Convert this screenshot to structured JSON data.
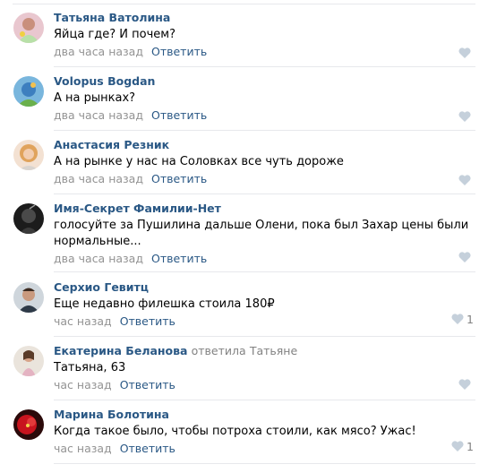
{
  "comments": [
    {
      "author": "Татьяна Ватолина",
      "text": "Яйца где? И почем?",
      "date": "два часа назад",
      "reply_label": "Ответить",
      "likes": ""
    },
    {
      "author": "Volopus Bogdan",
      "text": "А на рынках?",
      "date": "два часа назад",
      "reply_label": "Ответить",
      "likes": ""
    },
    {
      "author": "Анастасия Резник",
      "text": "А на рынке у нас на Соловках все чуть дороже",
      "date": "два часа назад",
      "reply_label": "Ответить",
      "likes": ""
    },
    {
      "author": "Имя-Секрет Фамилии-Нет",
      "text": "голосуйте за Пушилина дальше Олени, пока был Захар цены были нормальные...",
      "date": "два часа назад",
      "reply_label": "Ответить",
      "likes": ""
    },
    {
      "author": "Серхио Гевитц",
      "text": "Еще недавно филешка стоила 180₽",
      "date": "час назад",
      "reply_label": "Ответить",
      "likes": "1"
    },
    {
      "author": "Екатерина Беланова",
      "replied_word": "ответила",
      "reply_to": "Татьяне",
      "text": "Татьяна, 63",
      "date": "час назад",
      "reply_label": "Ответить",
      "likes": ""
    },
    {
      "author": "Марина Болотина",
      "text": "Когда такое было, чтобы потроха стоили, как мясо? Ужас!",
      "date": "час назад",
      "reply_label": "Ответить",
      "likes": "1"
    }
  ],
  "colors": {
    "author": "#2a5885",
    "date": "#939393",
    "like_icon": "#c5d0db",
    "separator": "#e7e8ec"
  },
  "icons": {
    "like": "heart-icon"
  }
}
